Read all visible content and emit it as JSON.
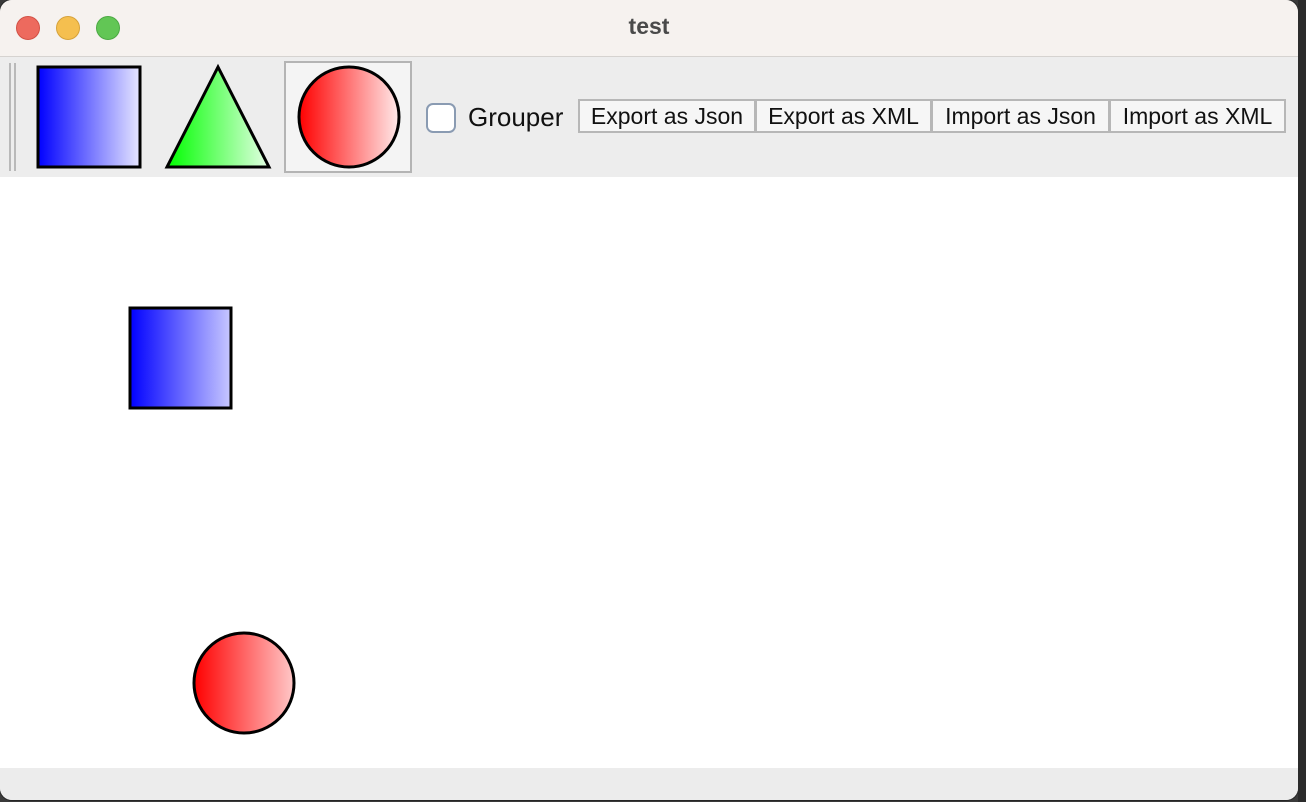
{
  "window": {
    "title": "test"
  },
  "toolbar": {
    "tools": [
      {
        "name": "rectangle-tool",
        "icon": "blue-gradient-square-icon",
        "selected": false
      },
      {
        "name": "triangle-tool",
        "icon": "green-gradient-triangle-icon",
        "selected": false
      },
      {
        "name": "circle-tool",
        "icon": "red-gradient-circle-icon",
        "selected": true
      }
    ],
    "grouper": {
      "label": "Grouper",
      "checked": false
    },
    "buttons": {
      "export_json": "Export as Json",
      "export_xml": "Export as XML",
      "import_json": "Import as Json",
      "import_xml": "Import as XML"
    }
  },
  "canvas": {
    "shapes": [
      {
        "type": "square",
        "fill": "blue-gradient"
      },
      {
        "type": "circle",
        "fill": "red-gradient"
      }
    ]
  },
  "colors": {
    "blue": "#0000ff",
    "green": "#00ff00",
    "red": "#ff0000",
    "titlebar": "#f6f2ef",
    "toolbar": "#ededed",
    "canvas": "#ffffff"
  }
}
